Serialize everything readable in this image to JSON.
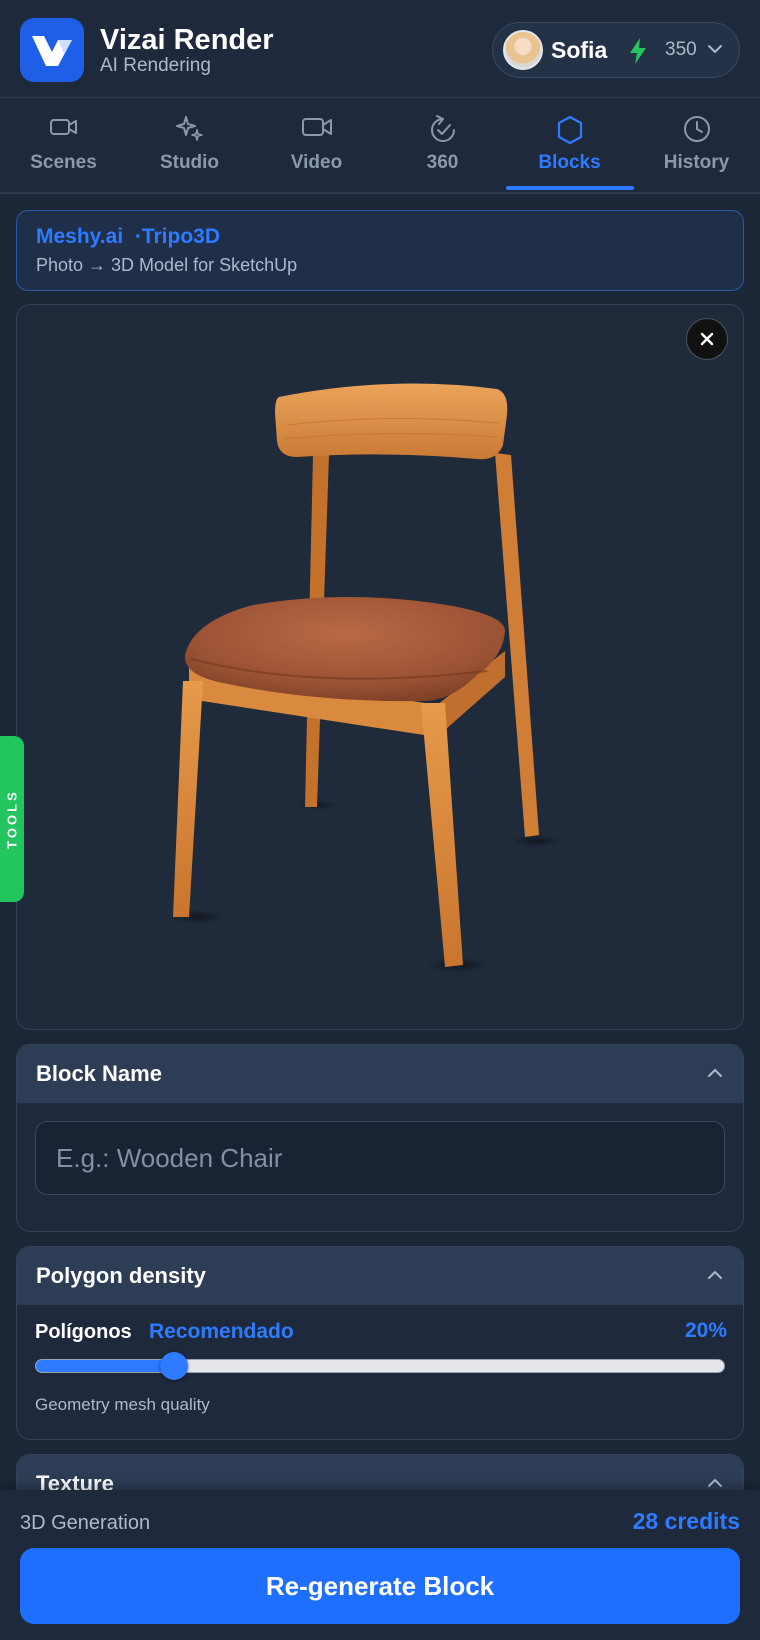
{
  "app": {
    "title": "Vizai Render",
    "subtitle": "AI Rendering"
  },
  "user": {
    "name": "Sofia",
    "credits": "350"
  },
  "tabs": [
    {
      "label": "Scenes",
      "icon": "video-camera-icon"
    },
    {
      "label": "Studio",
      "icon": "sparkles-icon"
    },
    {
      "label": "Video",
      "icon": "video-icon"
    },
    {
      "label": "360",
      "icon": "rotate-360-icon"
    },
    {
      "label": "Blocks",
      "icon": "hexagon-icon",
      "active": true
    },
    {
      "label": "History",
      "icon": "clock-icon"
    }
  ],
  "provider": {
    "names": "Meshy.ai  ·Tripo3D",
    "description": "Photo → 3D Model for SketchUp"
  },
  "preview": {
    "subject": "wooden chair with brown leather seat"
  },
  "tools": {
    "label": "TOOLS"
  },
  "block_name": {
    "title": "Block Name",
    "placeholder": "E.g.: Wooden Chair",
    "value": ""
  },
  "polygon_density": {
    "title": "Polygon density",
    "label": "Polígonos",
    "recommendation": "Recomendado",
    "value_text": "20%",
    "value": 0.2,
    "hint": "Geometry mesh quality"
  },
  "texture": {
    "title": "Texture"
  },
  "footer": {
    "label": "3D Generation",
    "credits": "28 credits",
    "button": "Re-generate Block"
  },
  "colors": {
    "accent": "#2f7bff",
    "background": "#1b2637",
    "tools": "#22c55e",
    "bolt": "#22c55e"
  }
}
